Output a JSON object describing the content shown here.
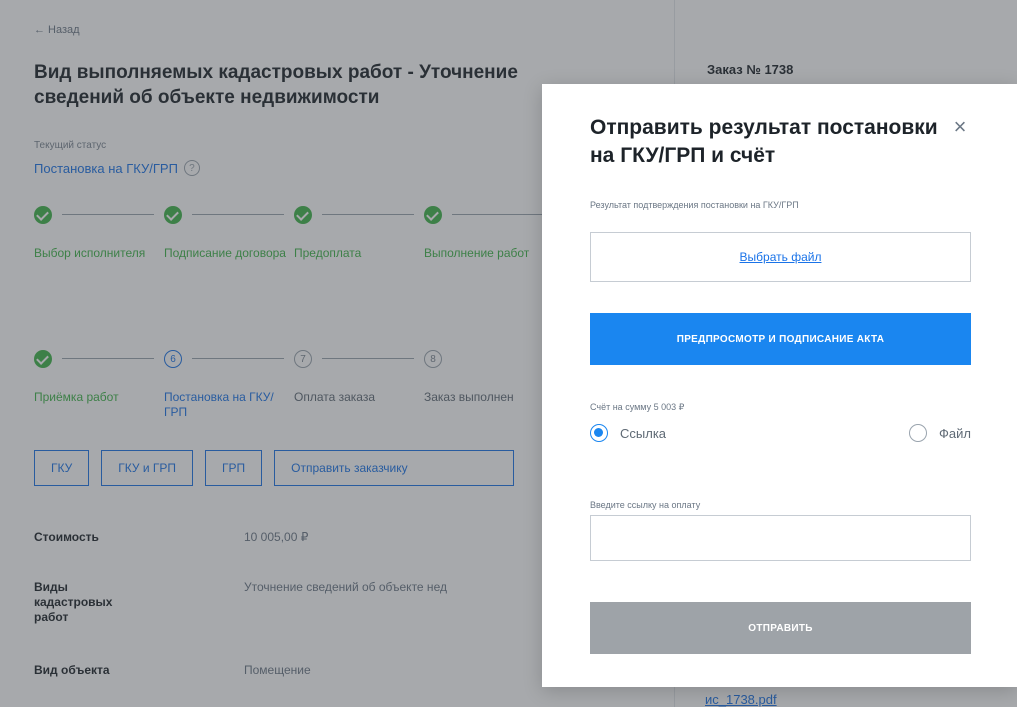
{
  "background": {
    "back_link": "← Назад",
    "title": "Вид выполняемых кадастровых работ - Уточнение сведений об объекте недвижимости",
    "status_caption": "Текущий статус",
    "status_value": "Постановка на ГКУ/ГРП",
    "help_icon": "?",
    "steps_row1": [
      {
        "label": "Выбор исполнителя",
        "state": "done"
      },
      {
        "label": "Подписание договора",
        "state": "done"
      },
      {
        "label": "Предоплата",
        "state": "done"
      },
      {
        "label": "Выполнение работ",
        "state": "done"
      }
    ],
    "steps_row2": [
      {
        "label": "Приёмка работ",
        "state": "done",
        "num": ""
      },
      {
        "label": "Постановка на ГКУ/ГРП",
        "state": "active",
        "num": "6"
      },
      {
        "label": "Оплата заказа",
        "state": "todo",
        "num": "7"
      },
      {
        "label": "Заказ выполнен",
        "state": "todo",
        "num": "8"
      }
    ],
    "tag_buttons": [
      "ГКУ",
      "ГКУ и ГРП",
      "ГРП",
      "Отправить заказчику"
    ],
    "info": [
      {
        "key": "Стоимость",
        "value": "10 005,00 ₽"
      },
      {
        "key": "Виды кадастровых работ",
        "value": "Уточнение сведений об объекте нед"
      },
      {
        "key": "Вид объекта",
        "value": "Помещение"
      }
    ],
    "order_number": "Заказ № 1738",
    "doc_link": "ис_1738.pdf"
  },
  "modal": {
    "title": "Отправить результат постановки на ГКУ/ГРП и счёт",
    "close_glyph": "×",
    "file_caption": "Результат подтверждения постановки на ГКУ/ГРП",
    "file_link": "Выбрать файл",
    "preview_button": "ПРЕДПРОСМОТР И ПОДПИСАНИЕ АКТА",
    "invoice_caption": "Счёт на сумму 5 003 ₽",
    "radio_options": [
      {
        "label": "Ссылка",
        "selected": true
      },
      {
        "label": "Файл",
        "selected": false
      }
    ],
    "link_caption": "Введите ссылку на оплату",
    "link_value": "",
    "submit_button": "ОТПРАВИТЬ"
  },
  "colors": {
    "accent": "#1a86f0",
    "link": "#1a73e8",
    "success": "#3fb549",
    "disabled": "#9ea3a8"
  }
}
